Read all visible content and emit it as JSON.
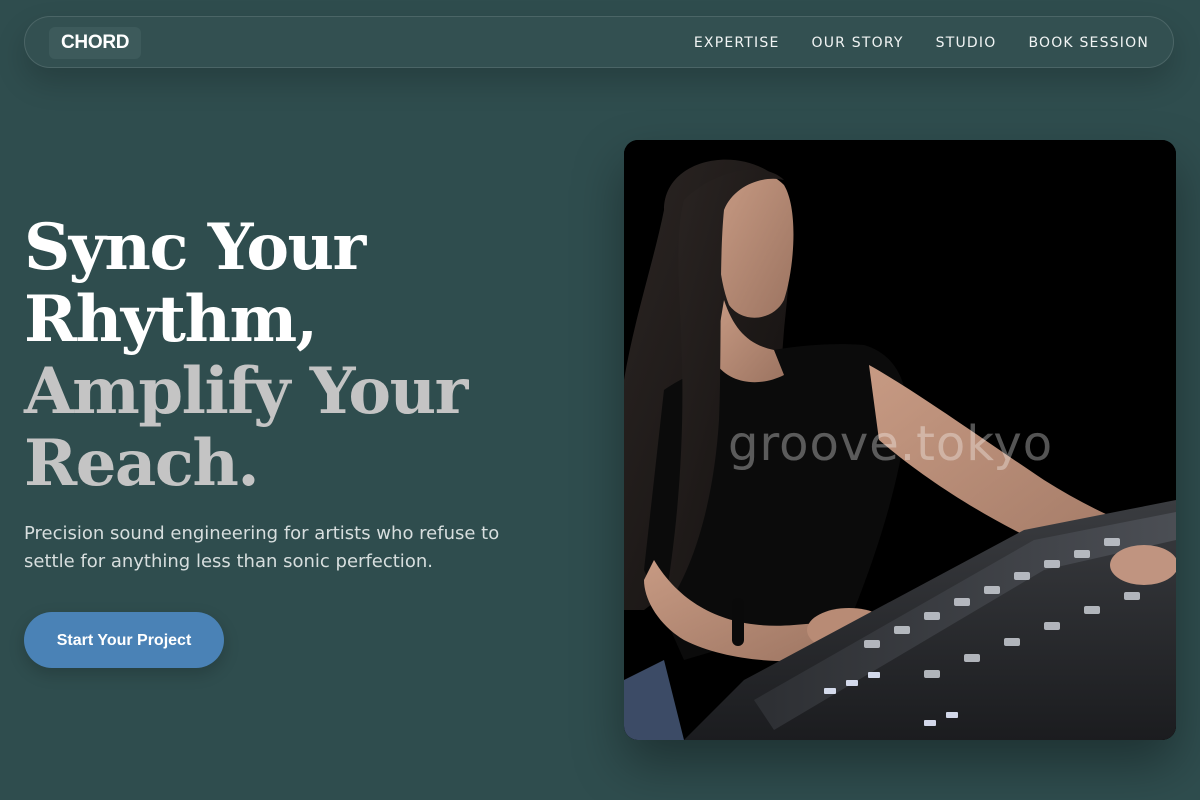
{
  "brand": {
    "logo": "CHORD"
  },
  "nav": {
    "items": [
      {
        "label": "EXPERTISE"
      },
      {
        "label": "OUR STORY"
      },
      {
        "label": "STUDIO"
      },
      {
        "label": "BOOK SESSION"
      }
    ]
  },
  "hero": {
    "headline_line1": "Sync Your",
    "headline_line2": "Rhythm,",
    "headline_line3": "Amplify Your",
    "headline_line4": "Reach.",
    "subtext": "Precision sound engineering for artists who refuse to settle for anything less than sonic perfection.",
    "cta_label": "Start Your Project"
  },
  "photo": {
    "watermark": "groove.tokyo"
  },
  "colors": {
    "background": "#2f4d4e",
    "accent": "#4a82b6",
    "headline_primary": "#ffffff",
    "headline_secondary": "#c4c4c4"
  }
}
